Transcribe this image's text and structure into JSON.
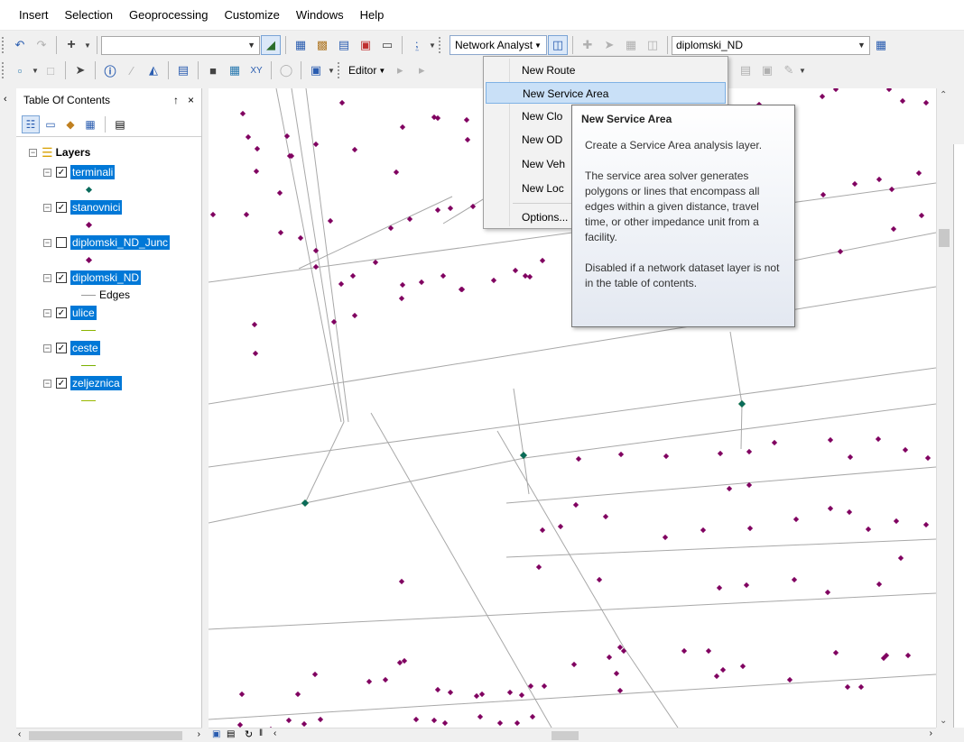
{
  "menubar": {
    "items": [
      "Insert",
      "Selection",
      "Geoprocessing",
      "Customize",
      "Windows",
      "Help"
    ]
  },
  "toolbar": {
    "network_analyst_label": "Network Analyst",
    "network_dataset_value": "diplomski_ND",
    "editor_label": "Editor"
  },
  "toc": {
    "title": "Table Of Contents",
    "pin_glyph": "2",
    "close_glyph": "×",
    "layers_label": "Layers",
    "layers": [
      {
        "name": "terminali",
        "checked": true,
        "legend": "point",
        "color": "#0a6b5c"
      },
      {
        "name": "stanovnici",
        "checked": true,
        "legend": "point",
        "color": "#800060"
      },
      {
        "name": "diplomski_ND_Junc",
        "checked": false,
        "legend": "point",
        "color": "#800060"
      },
      {
        "name": "diplomski_ND",
        "checked": true,
        "legend": "line",
        "legend_label": "Edges",
        "color": "#9a9a9a"
      },
      {
        "name": "ulice",
        "checked": true,
        "legend": "line",
        "color": "#8cb400"
      },
      {
        "name": "ceste",
        "checked": true,
        "legend": "line",
        "color": "#7ab000"
      },
      {
        "name": "zeljeznica",
        "checked": true,
        "legend": "line",
        "color": "#9ab800"
      }
    ]
  },
  "dropdown": {
    "items": [
      "New Route",
      "New Service Area",
      "New Clo",
      "New OD",
      "New Veh",
      "New Loc",
      "Options..."
    ],
    "highlighted": "New Service Area"
  },
  "tooltip": {
    "title": "New Service Area",
    "p1": "Create a Service Area analysis layer.",
    "p2": "The service area solver generates polygons or lines that encompass all edges within a given distance, travel time, or other impedance unit from a facility.",
    "p3": "Disabled if a network dataset layer is not in the table of contents."
  },
  "colors": {
    "selection": "#0078d7",
    "point": "#800060",
    "terminal": "#0a6b5c",
    "road": "#9a9a9a",
    "menu_highlight": "#c9e0f7"
  },
  "map_data": {
    "points": [
      [
        38,
        28
      ],
      [
        148,
        16
      ],
      [
        250,
        32
      ],
      [
        286,
        35
      ],
      [
        329,
        30
      ],
      [
        441,
        10
      ],
      [
        505,
        28
      ],
      [
        559,
        46
      ],
      [
        610,
        18
      ],
      [
        647,
        31
      ],
      [
        680,
        9
      ],
      [
        695,
        1
      ],
      [
        754,
        1
      ],
      [
        769,
        14
      ],
      [
        795,
        16
      ],
      [
        44,
        54
      ],
      [
        87,
        53
      ],
      [
        119,
        62
      ],
      [
        162,
        68
      ],
      [
        215,
        43
      ],
      [
        254,
        33
      ],
      [
        287,
        57
      ],
      [
        324,
        48
      ],
      [
        359,
        30
      ],
      [
        54,
        67
      ],
      [
        92,
        75
      ],
      [
        90,
        75
      ],
      [
        208,
        93
      ],
      [
        268,
        133
      ],
      [
        373,
        65
      ],
      [
        410,
        75
      ],
      [
        472,
        82
      ],
      [
        53,
        92
      ],
      [
        79,
        116
      ],
      [
        135,
        147
      ],
      [
        202,
        155
      ],
      [
        223,
        145
      ],
      [
        254,
        135
      ],
      [
        293,
        131
      ],
      [
        339,
        125
      ],
      [
        375,
        93
      ],
      [
        467,
        82
      ],
      [
        582,
        129
      ],
      [
        610,
        111
      ],
      [
        625,
        90
      ],
      [
        681,
        118
      ],
      [
        716,
        106
      ],
      [
        743,
        101
      ],
      [
        757,
        112
      ],
      [
        787,
        94
      ],
      [
        5,
        140
      ],
      [
        42,
        140
      ],
      [
        80,
        160
      ],
      [
        160,
        208
      ],
      [
        102,
        166
      ],
      [
        119,
        180
      ],
      [
        119,
        198
      ],
      [
        147,
        217
      ],
      [
        185,
        193
      ],
      [
        215,
        218
      ],
      [
        236,
        215
      ],
      [
        260,
        208
      ],
      [
        280,
        223
      ],
      [
        316,
        213
      ],
      [
        340,
        202
      ],
      [
        356,
        209
      ],
      [
        370,
        191
      ],
      [
        413,
        199
      ],
      [
        440,
        197
      ],
      [
        490,
        209
      ],
      [
        519,
        226
      ],
      [
        700,
        181
      ],
      [
        759,
        156
      ],
      [
        790,
        141
      ],
      [
        52,
        294
      ],
      [
        51,
        262
      ],
      [
        139,
        259
      ],
      [
        162,
        252
      ],
      [
        214,
        233
      ],
      [
        281,
        223
      ],
      [
        351,
        208
      ],
      [
        410,
        411
      ],
      [
        457,
        406
      ],
      [
        507,
        408
      ],
      [
        567,
        405
      ],
      [
        599,
        403
      ],
      [
        627,
        393
      ],
      [
        689,
        390
      ],
      [
        711,
        409
      ],
      [
        742,
        389
      ],
      [
        772,
        401
      ],
      [
        797,
        410
      ],
      [
        577,
        444
      ],
      [
        599,
        440
      ],
      [
        407,
        462
      ],
      [
        440,
        475
      ],
      [
        506,
        498
      ],
      [
        548,
        490
      ],
      [
        600,
        488
      ],
      [
        651,
        478
      ],
      [
        689,
        466
      ],
      [
        710,
        470
      ],
      [
        731,
        489
      ],
      [
        762,
        480
      ],
      [
        795,
        484
      ],
      [
        370,
        490
      ],
      [
        390,
        486
      ],
      [
        366,
        531
      ],
      [
        433,
        545
      ],
      [
        566,
        554
      ],
      [
        596,
        551
      ],
      [
        649,
        545
      ],
      [
        686,
        559
      ],
      [
        743,
        550
      ],
      [
        767,
        521
      ],
      [
        214,
        547
      ],
      [
        456,
        620
      ],
      [
        452,
        649
      ],
      [
        456,
        668
      ],
      [
        563,
        652
      ],
      [
        592,
        641
      ],
      [
        644,
        656
      ],
      [
        695,
        626
      ],
      [
        748,
        632
      ],
      [
        775,
        629
      ],
      [
        118,
        650
      ],
      [
        99,
        672
      ],
      [
        178,
        658
      ],
      [
        196,
        656
      ],
      [
        212,
        637
      ],
      [
        254,
        667
      ],
      [
        268,
        670
      ],
      [
        297,
        674
      ],
      [
        303,
        672
      ],
      [
        334,
        670
      ],
      [
        347,
        673
      ],
      [
        357,
        663
      ],
      [
        372,
        663
      ],
      [
        37,
        672
      ],
      [
        35,
        706
      ],
      [
        69,
        711
      ],
      [
        89,
        701
      ],
      [
        106,
        705
      ],
      [
        124,
        700
      ],
      [
        230,
        700
      ],
      [
        250,
        701
      ],
      [
        262,
        704
      ],
      [
        301,
        697
      ],
      [
        323,
        704
      ],
      [
        342,
        704
      ],
      [
        359,
        697
      ],
      [
        708,
        664
      ],
      [
        723,
        664
      ],
      [
        751,
        629
      ],
      [
        217,
        635
      ],
      [
        444,
        631
      ],
      [
        405,
        639
      ],
      [
        460,
        624
      ],
      [
        527,
        624
      ],
      [
        554,
        624
      ],
      [
        570,
        645
      ]
    ],
    "junctions": [
      [
        591,
        350
      ],
      [
        349,
        407
      ],
      [
        107,
        460
      ]
    ],
    "roads": [
      "M 75 0 L 147 370",
      "M 92 0 L 150 370",
      "M 108 0 L 155 370",
      "M 0 215 L 806 105",
      "M 0 350 L 806 220",
      "M 0 420 L 806 310",
      "M 0 482 L 350 410 L 806 350",
      "M 0 600 L 806 560",
      "M 0 700 L 806 650",
      "M 320 380 L 460 620 L 520 709",
      "M 180 360 L 380 709",
      "M 150 370 L 107 460",
      "M 338 333 L 349 407 L 355 450",
      "M 578 270 L 591 350 L 590 400",
      "M 260 150 L 440 40 L 540 0",
      "M 100 200 L 270 120",
      "M 500 220 L 806 160",
      "M 330 460 L 806 420",
      "M 330 520 L 806 500"
    ]
  }
}
